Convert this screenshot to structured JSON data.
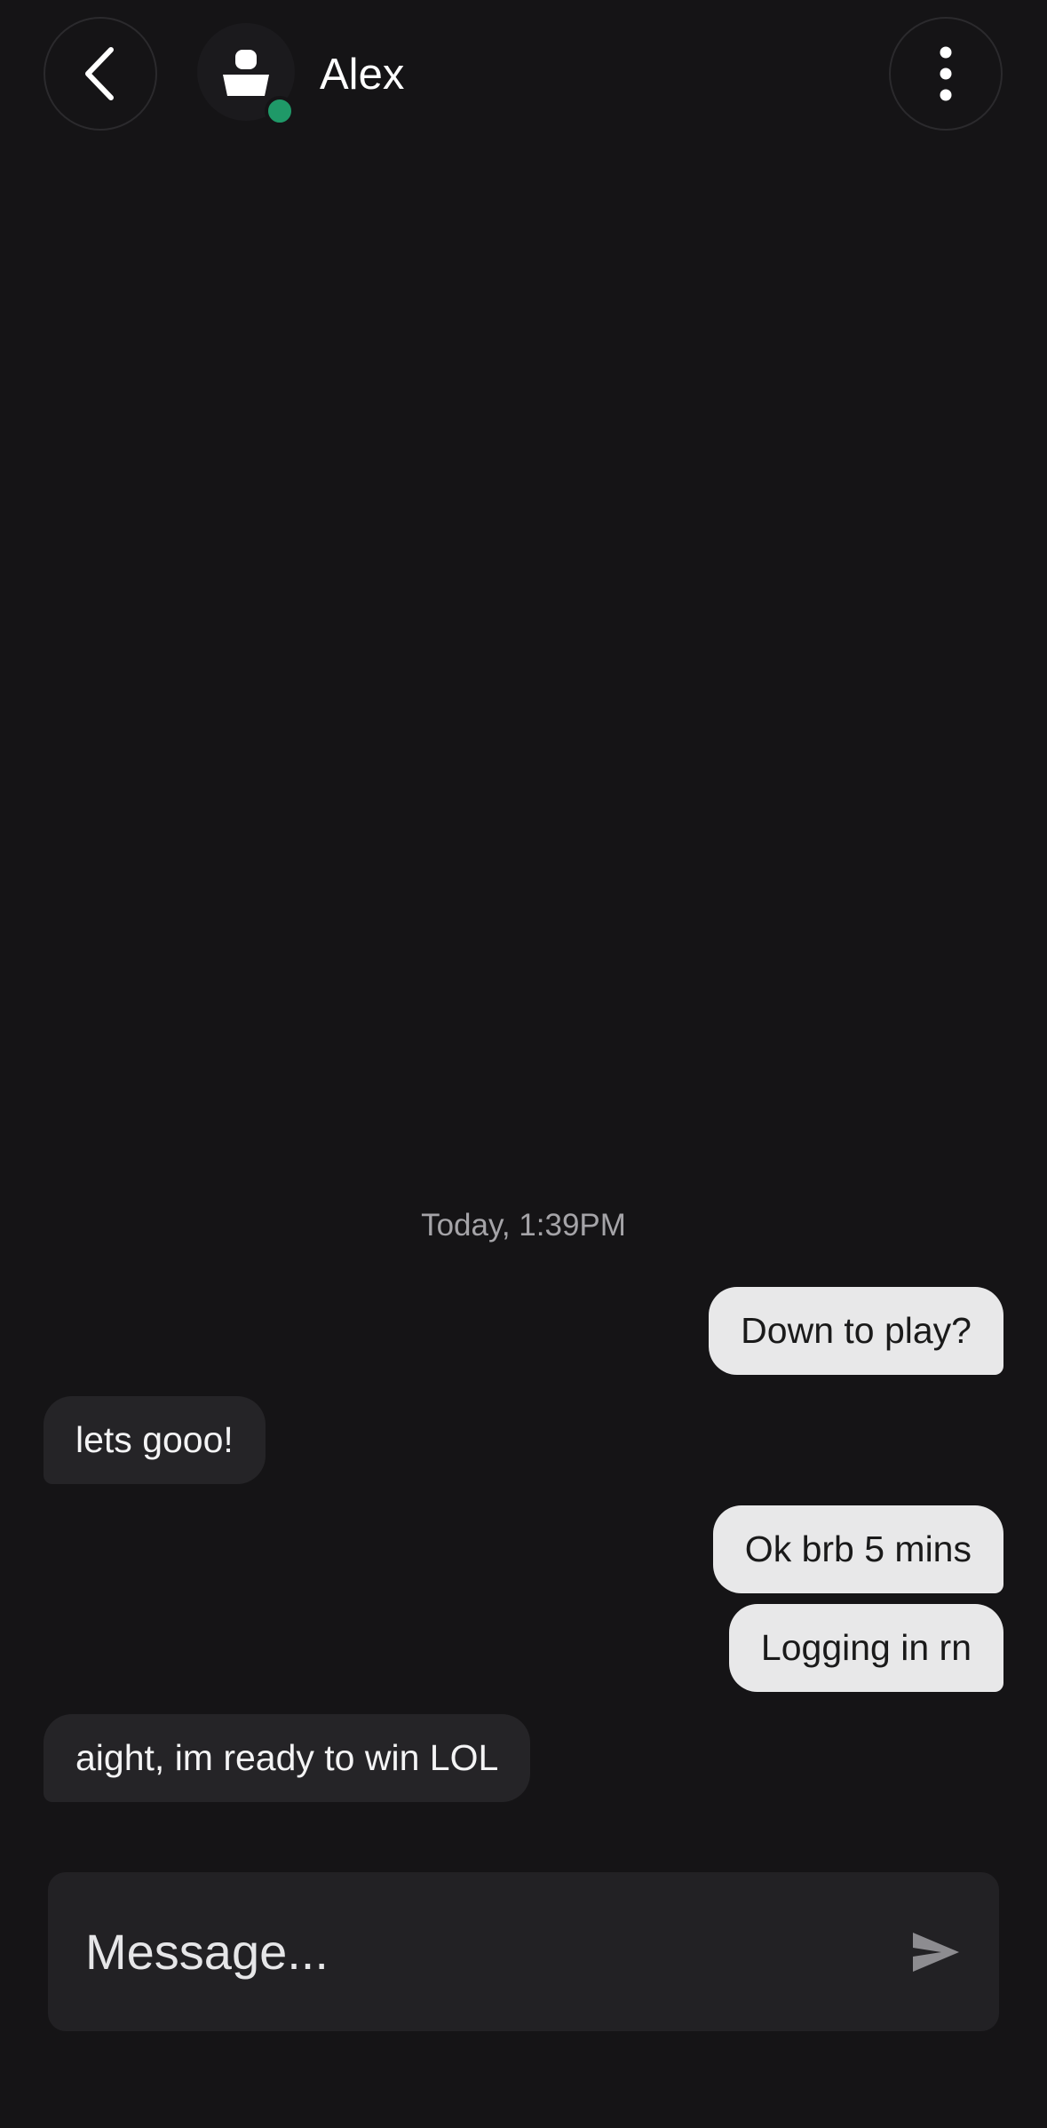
{
  "header": {
    "contact_name": "Alex",
    "status": "online",
    "status_color": "#1f9968",
    "back_icon": "chevron-left-icon",
    "menu_icon": "more-vertical-icon",
    "avatar_icon": "user-icon"
  },
  "conversation": {
    "timestamp": "Today, 1:39PM",
    "messages": [
      {
        "direction": "outgoing",
        "text": "Down to play?"
      },
      {
        "direction": "incoming",
        "text": "lets gooo!"
      },
      {
        "direction": "outgoing",
        "text": "Ok brb 5 mins"
      },
      {
        "direction": "outgoing",
        "text": "Logging in rn"
      },
      {
        "direction": "incoming",
        "text": "aight, im ready to win LOL"
      }
    ]
  },
  "composer": {
    "placeholder": "Message...",
    "value": "",
    "send_icon": "send-icon"
  },
  "colors": {
    "background": "#151416",
    "outgoing_bubble": "#e8e8e9",
    "incoming_bubble": "#252427",
    "composer": "#222124"
  }
}
